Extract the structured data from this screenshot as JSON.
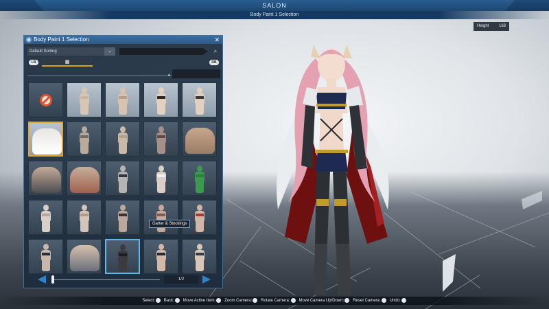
{
  "header": {
    "title": "SALON",
    "subtitle": "Body Paint 1 Selection"
  },
  "height_readout": {
    "label": "Height",
    "value": "168"
  },
  "panel": {
    "title": "Body Paint 1 Selection",
    "close_label": "✕",
    "sort": {
      "label": "Default Sorting",
      "chevron": "⌄"
    },
    "search_icon": "⌕",
    "tabs": {
      "lb": "LB",
      "rb": "RB",
      "active_icon": "▦"
    },
    "grid": [
      {
        "type": "none"
      },
      {
        "type": "figure",
        "tone": "light",
        "skin": "#d8c6b4",
        "accent": "#c9b7a4"
      },
      {
        "type": "figure",
        "tone": "light",
        "skin": "#d6c3b0",
        "accent": "#b89f8a"
      },
      {
        "type": "figure",
        "tone": "light",
        "skin": "#e2d1c0",
        "accent": "#2b2b2b"
      },
      {
        "type": "figure",
        "tone": "light",
        "skin": "#e2d1c0",
        "accent": "#3a3a3a"
      },
      {
        "type": "chest",
        "tone": "light",
        "skin": "#e9e6e2",
        "accent": "#ffffff",
        "selected": true
      },
      {
        "type": "figure",
        "tone": "dark",
        "skin": "#b9aa9c",
        "accent": "#6f6a66"
      },
      {
        "type": "figure",
        "tone": "dark",
        "skin": "#cbb9a8",
        "accent": "#b3a08e"
      },
      {
        "type": "figure",
        "tone": "dark",
        "skin": "#a8908a",
        "accent": "#5b4b4b"
      },
      {
        "type": "chest",
        "tone": "dark",
        "skin": "#c7a68c",
        "accent": "#9a7c66"
      },
      {
        "type": "chest",
        "tone": "dark",
        "skin": "#c4ab98",
        "accent": "#4d4d52"
      },
      {
        "type": "chest",
        "tone": "dark",
        "skin": "#c7ae9c",
        "accent": "#a0614f"
      },
      {
        "type": "figure",
        "tone": "dark",
        "skin": "#b7b3b2",
        "accent": "#2f3340"
      },
      {
        "type": "figure",
        "tone": "dark",
        "skin": "#d9cfc7",
        "accent": "#efefef"
      },
      {
        "type": "figure",
        "tone": "dark",
        "skin": "#3a9b4e",
        "accent": "#2f7e3d"
      },
      {
        "type": "figure",
        "tone": "dark",
        "skin": "#d9d0c9",
        "accent": "#b6a69b"
      },
      {
        "type": "figure",
        "tone": "dark",
        "skin": "#d3c5ba",
        "accent": "#b09a8a"
      },
      {
        "type": "figure",
        "tone": "dark",
        "skin": "#bda79a",
        "accent": "#3b3333"
      },
      {
        "type": "figure",
        "tone": "dark",
        "skin": "#c9a89a",
        "accent": "#7a5b55"
      },
      {
        "type": "figure",
        "tone": "dark",
        "skin": "#d0b6a6",
        "accent": "#a33a3a"
      },
      {
        "type": "figure",
        "tone": "dark",
        "skin": "#c8b8ab",
        "accent": "#2a2d36"
      },
      {
        "type": "chest",
        "tone": "dark",
        "skin": "#d5c0ae",
        "accent": "#6a6f7a"
      },
      {
        "type": "figure",
        "tone": "dark",
        "skin": "#3c3a3e",
        "accent": "#1e1e22",
        "hover": true
      },
      {
        "type": "figure",
        "tone": "dark",
        "skin": "#d2b9a7",
        "accent": "#2a2a30"
      },
      {
        "type": "figure",
        "tone": "dark",
        "skin": "#d8c6b8",
        "accent": "#3a3a44"
      }
    ],
    "tooltip": "Garter & Stockings",
    "pager": {
      "page": "1/2",
      "progress": 0.0
    }
  },
  "controls": [
    {
      "label": "Select:",
      "button": "A"
    },
    {
      "label": "Back:",
      "button": "B"
    },
    {
      "label": "Move Active Item:",
      "button": "L"
    },
    {
      "label": "Zoom Camera:",
      "button": "LT"
    },
    {
      "label": "Rotate Camera:",
      "button": "R"
    },
    {
      "label": "Move Camera Up/Down:",
      "button": "RS"
    },
    {
      "label": "Reset Camera:",
      "button": "RB"
    },
    {
      "label": "Undo:",
      "button": "Y"
    }
  ],
  "colors": {
    "accent_blue": "#2f83c9",
    "selection_gold": "#e0a62c",
    "hover_cyan": "#62b7e6",
    "hair_pink": "#e7a6b4",
    "outfit_navy": "#1f2a52",
    "cape_red": "#7a1414"
  }
}
